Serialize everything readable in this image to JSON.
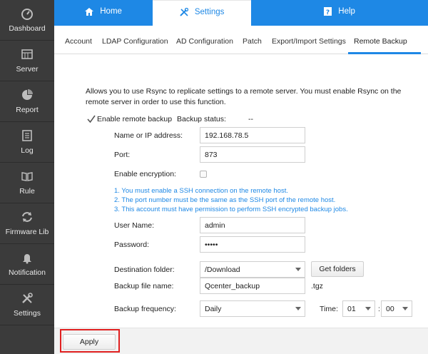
{
  "sidebar": {
    "items": [
      {
        "label": "Dashboard",
        "icon": "gauge-icon"
      },
      {
        "label": "Server",
        "icon": "server-icon"
      },
      {
        "label": "Report",
        "icon": "pie-chart-icon"
      },
      {
        "label": "Log",
        "icon": "log-icon"
      },
      {
        "label": "Rule",
        "icon": "book-icon"
      },
      {
        "label": "Firmware Lib",
        "icon": "refresh-icon"
      },
      {
        "label": "Notification",
        "icon": "bell-icon"
      },
      {
        "label": "Settings",
        "icon": "tools-icon"
      }
    ]
  },
  "topnav": {
    "home": "Home",
    "settings": "Settings",
    "help": "Help"
  },
  "subtabs": [
    "Account",
    "LDAP Configuration",
    "AD Configuration",
    "Patch",
    "Export/Import Settings",
    "Remote Backup"
  ],
  "colors": {
    "accent": "#1e88e5",
    "sidebar": "#3b3b3b",
    "highlight": "#e02020"
  },
  "form": {
    "description": "Allows you to use Rsync to replicate settings to a remote server. You must enable Rsync on the remote server in order to use this function.",
    "enable_remote_backup": "Enable remote backup",
    "backup_status_label": "Backup status:",
    "backup_status_value": "--",
    "name_label": "Name or IP address:",
    "name_value": "192.168.78.5",
    "port_label": "Port:",
    "port_value": "873",
    "encryption_label": "Enable encryption:",
    "notes": [
      "1. You must enable a SSH connection on the remote host.",
      "2. The port number must be the same as the SSH port of the remote host.",
      "3. This account must have permission to perform SSH encrypted backup jobs."
    ],
    "username_label": "User Name:",
    "username_value": "admin",
    "password_label": "Password:",
    "password_value": "•••••",
    "dest_label": "Destination folder:",
    "dest_value": "/Download",
    "get_folders": "Get folders",
    "file_label": "Backup file name:",
    "file_value": "Qcenter_backup",
    "file_ext": ".tgz",
    "freq_label": "Backup frequency:",
    "freq_value": "Daily",
    "time_label": "Time:",
    "time_hour": "01",
    "time_min": "00"
  },
  "footer": {
    "apply": "Apply"
  }
}
